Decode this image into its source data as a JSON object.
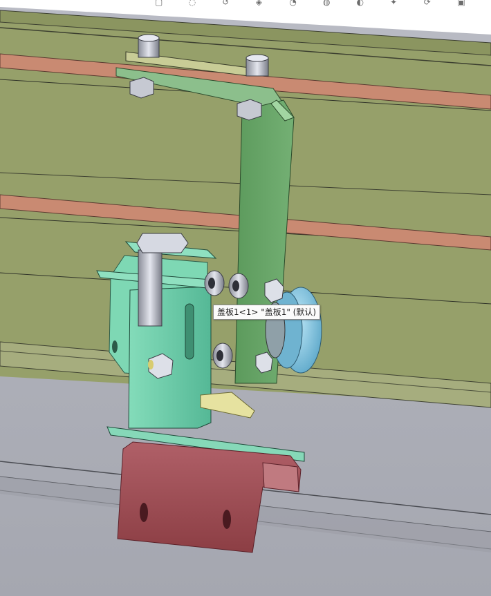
{
  "viewport": {
    "tooltip": "盖板1<1> \"盖板1\" (默认)"
  },
  "heads_up_toolbar": {
    "icons": [
      "zoom-to-fit-icon",
      "zoom-area-icon",
      "previous-view-icon",
      "section-view-icon",
      "view-orientation-icon",
      "display-style-icon",
      "hide-show-items-icon",
      "edit-appearance-icon",
      "apply-scene-icon",
      "view-settings-icon"
    ]
  },
  "colors": {
    "background_top": "#ffffff",
    "frame_olive": "#96a06a",
    "rail_salmon": "#c98a72",
    "bracket_green": "#66a066",
    "plate_mint": "#6cc8a8",
    "roller_blue": "#86c4de",
    "channel_red": "#a8545a",
    "floor_gray": "#b0b2ba"
  }
}
